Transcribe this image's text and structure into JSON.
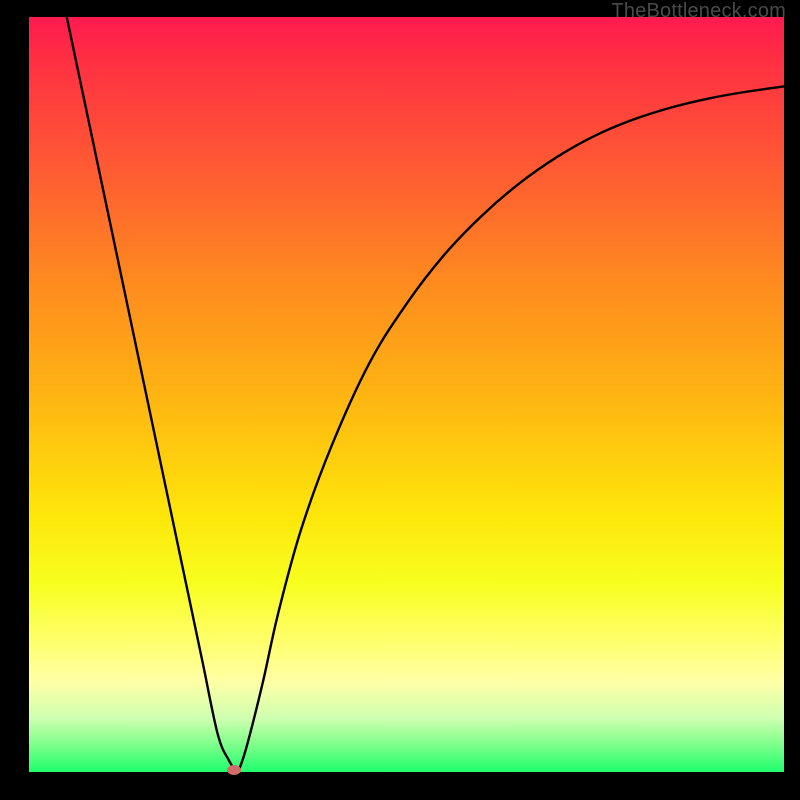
{
  "watermark": "TheBottleneck.com",
  "chart_data": {
    "type": "line",
    "title": "",
    "xlabel": "",
    "ylabel": "",
    "xlim": [
      0,
      100
    ],
    "ylim": [
      0,
      100
    ],
    "grid": false,
    "series": [
      {
        "name": "bottleneck-curve",
        "x": [
          5,
          7,
          9,
          11,
          13,
          15,
          17,
          19,
          21,
          23,
          25,
          26.5,
          27.5,
          28,
          29,
          31,
          33,
          36,
          40,
          45,
          50,
          55,
          60,
          65,
          70,
          75,
          80,
          85,
          90,
          95,
          100
        ],
        "y": [
          100,
          90.5,
          81,
          71.5,
          62,
          52.5,
          43,
          33.5,
          24,
          14.5,
          5,
          1.5,
          0.2,
          0.8,
          4,
          12,
          21,
          32,
          43,
          54,
          62,
          68.5,
          73.7,
          78,
          81.5,
          84.3,
          86.4,
          88,
          89.2,
          90.1,
          90.8
        ]
      }
    ],
    "marker": {
      "x_pct": 27.2,
      "y_pct": 0.2
    },
    "gradient_stops": [
      {
        "pct": 0,
        "color": "#ff1a4f"
      },
      {
        "pct": 6,
        "color": "#ff3042"
      },
      {
        "pct": 20,
        "color": "#ff5a33"
      },
      {
        "pct": 35,
        "color": "#fe8a1f"
      },
      {
        "pct": 50,
        "color": "#feb412"
      },
      {
        "pct": 66,
        "color": "#fee60a"
      },
      {
        "pct": 75,
        "color": "#f7ff1e"
      },
      {
        "pct": 82,
        "color": "#ffff65"
      },
      {
        "pct": 88,
        "color": "#ffffa6"
      },
      {
        "pct": 93,
        "color": "#cdffb0"
      },
      {
        "pct": 96,
        "color": "#87ff8e"
      },
      {
        "pct": 100,
        "color": "#1fff6d"
      }
    ]
  }
}
